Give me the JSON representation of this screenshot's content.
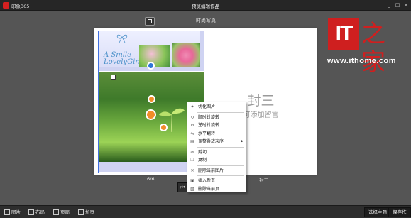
{
  "app": {
    "name": "印象365",
    "window_title": "预览编辑作品",
    "controls": {
      "minimize": "_",
      "maximize": "□",
      "close": "×"
    }
  },
  "canvas": {
    "layout_name": "时尚写真",
    "left_page": {
      "title_line1": "A Smile",
      "title_line2": "LovelyGirl",
      "label": "6/6"
    },
    "right_page": {
      "title": "封三",
      "subtitle": "可添加留言",
      "label": "封三"
    }
  },
  "context_menu": {
    "items": [
      {
        "label": "优化图片",
        "icon": "magic-wand-icon"
      },
      {
        "label": "顺时针旋转",
        "icon": "rotate-cw-icon"
      },
      {
        "label": "逆时针旋转",
        "icon": "rotate-ccw-icon"
      },
      {
        "label": "水平翻转",
        "icon": "flip-horizontal-icon"
      },
      {
        "label": "调整叠放次序",
        "icon": "layers-icon",
        "has_submenu": true
      },
      {
        "label": "剪切",
        "icon": "scissors-icon"
      },
      {
        "label": "复制",
        "icon": "copy-icon"
      },
      {
        "label": "删除当前图片",
        "icon": "delete-icon"
      },
      {
        "label": "插入新页",
        "icon": "insert-page-icon"
      },
      {
        "label": "删除当前页",
        "icon": "delete-page-icon"
      }
    ]
  },
  "toolbar": {
    "items": [
      {
        "label": "图片",
        "icon": "image-icon"
      },
      {
        "label": "布局",
        "icon": "layout-icon"
      },
      {
        "label": "页面",
        "icon": "page-icon"
      },
      {
        "label": "加页",
        "icon": "add-page-icon"
      }
    ],
    "select_theme": "选择主题",
    "save_work": "保存作品"
  },
  "watermark": {
    "logo_text": "IT",
    "logo_glyph": "之家",
    "url": "www.ithome.com"
  },
  "colors": {
    "accent": "#2f77d8",
    "handle": "#f08d2a",
    "brand": "#cf1f1f"
  }
}
